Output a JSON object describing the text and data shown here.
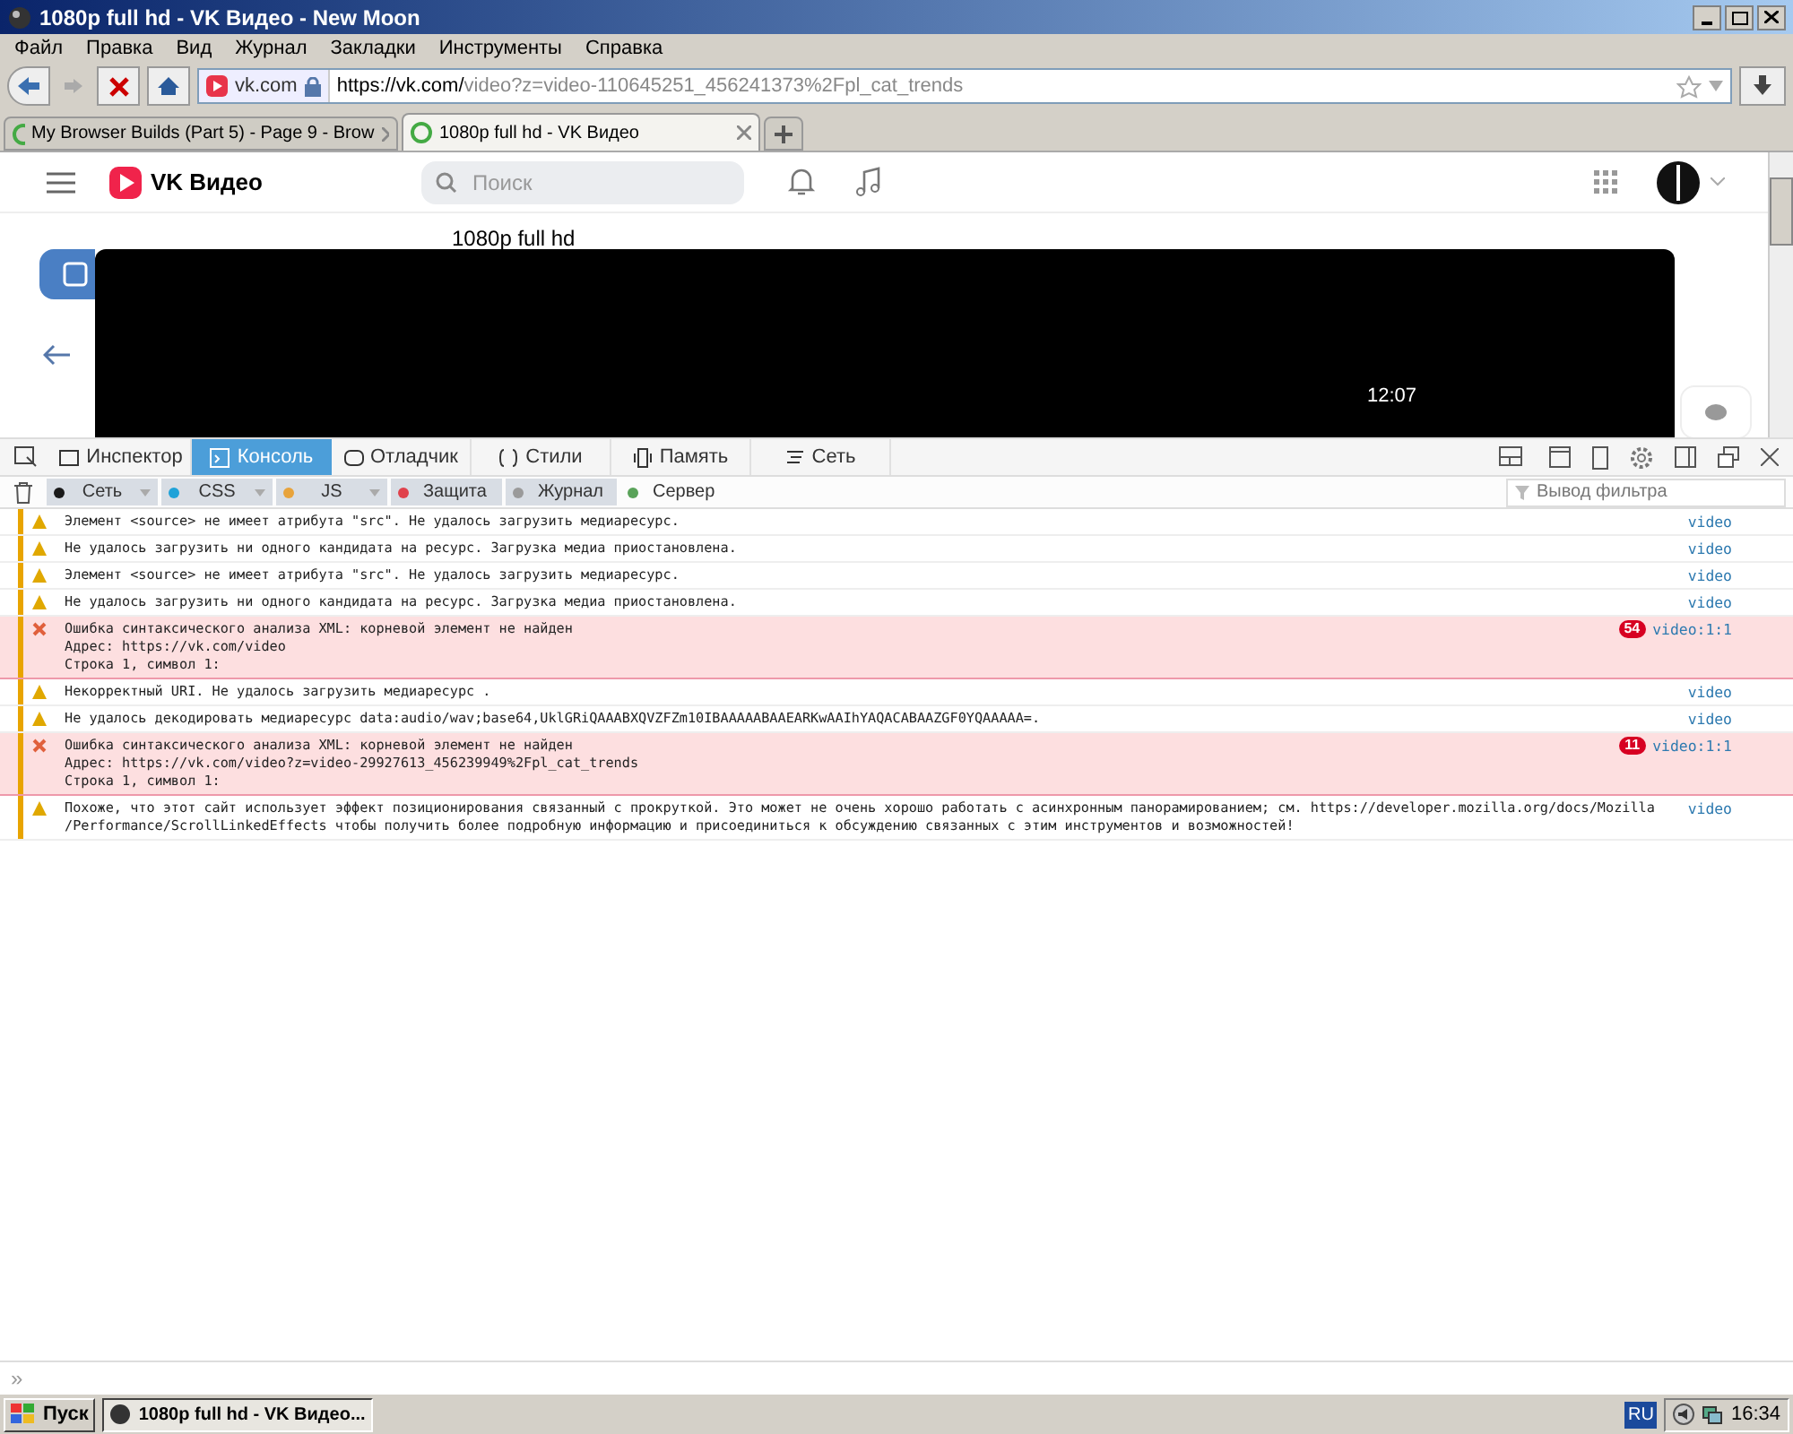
{
  "window": {
    "title": "1080p full hd - VK Видео - New Moon"
  },
  "menu": [
    "Файл",
    "Правка",
    "Вид",
    "Журнал",
    "Закладки",
    "Инструменты",
    "Справка"
  ],
  "address_bar": {
    "site": "vk.com",
    "url_host": "https://vk.com/",
    "url_path": "video?z=video-110645251_456241373%2Fpl_cat_trends"
  },
  "tabs": [
    {
      "label": "My Browser Builds (Part 5) - Page 9 - Brow",
      "selected": false
    },
    {
      "label": "1080p full hd - VK Видео",
      "selected": true
    }
  ],
  "page": {
    "logo": "VK Видео",
    "search": {
      "placeholder": "Поиск"
    },
    "video_title": "1080p full hd",
    "duration": "12:07"
  },
  "devtools": {
    "tabs": [
      {
        "label": "Инспектор",
        "selected": false
      },
      {
        "label": "Консоль",
        "selected": true
      },
      {
        "label": "Отладчик",
        "selected": false
      },
      {
        "label": "Стили",
        "selected": false
      },
      {
        "label": "Память",
        "selected": false
      },
      {
        "label": "Сеть",
        "selected": false
      }
    ],
    "filters": [
      {
        "label": "Сеть",
        "color": "#1a1a1a",
        "selected": true
      },
      {
        "label": "CSS",
        "color": "#1fa2d8",
        "selected": true
      },
      {
        "label": "JS",
        "color": "#e8a33b",
        "selected": true
      },
      {
        "label": "Защита",
        "color": "#e0424c",
        "selected": true
      },
      {
        "label": "Журнал",
        "color": "#9a9a9a",
        "selected": true
      },
      {
        "label": "Сервер",
        "color": "#5aa35a",
        "selected": false
      }
    ],
    "filter_field": {
      "placeholder": "Вывод фильтра"
    },
    "messages": [
      {
        "kind": "warning",
        "lines": [
          "Элемент <source> не имеет атрибута \"src\". Не удалось загрузить медиаресурс."
        ],
        "source": "video"
      },
      {
        "kind": "warning",
        "lines": [
          "Не удалось загрузить ни одного кандидата на ресурс. Загрузка медиа приостановлена."
        ],
        "source": "video"
      },
      {
        "kind": "warning",
        "lines": [
          "Элемент <source> не имеет атрибута \"src\". Не удалось загрузить медиаресурс."
        ],
        "source": "video"
      },
      {
        "kind": "warning",
        "lines": [
          "Не удалось загрузить ни одного кандидата на ресурс. Загрузка медиа приостановлена."
        ],
        "source": "video"
      },
      {
        "kind": "error",
        "lines": [
          "Ошибка синтаксического анализа XML: корневой элемент не найден",
          "Адрес: https://vk.com/video",
          "Строка 1, символ 1:"
        ],
        "count": "54",
        "source": "video:1:1"
      },
      {
        "kind": "warning",
        "lines": [
          "Некорректный URI. Не удалось загрузить медиаресурс ."
        ],
        "source": "video"
      },
      {
        "kind": "warning",
        "lines": [
          "Не удалось декодировать медиаресурс data:audio/wav;base64,UklGRiQAAABXQVZFZm10IBAAAAABAAEARKwAAIhYAQACABAAZGF0YQAAAAA=."
        ],
        "source": "video"
      },
      {
        "kind": "error",
        "lines": [
          "Ошибка синтаксического анализа XML: корневой элемент не найден",
          "Адрес: https://vk.com/video?z=video-29927613_456239949%2Fpl_cat_trends",
          "Строка 1, символ 1:"
        ],
        "count": "11",
        "source": "video:1:1"
      },
      {
        "kind": "warning",
        "lines": [
          "Похоже, что этот сайт использует эффект позиционирования связанный с прокруткой. Это может не очень хорошо работать с асинхронным панорамированием; см. https://developer.mozilla.org/docs/Mozilla",
          "/Performance/ScrollLinkedEffects чтобы получить более подробную информацию и присоединиться к обсуждению связанных с этим инструментов и возможностей!"
        ],
        "source": "video"
      }
    ],
    "prompt": "»"
  },
  "taskbar": {
    "start": "Пуск",
    "task": "1080p full hd - VK Видео...",
    "language": "RU",
    "time": "16:34"
  }
}
